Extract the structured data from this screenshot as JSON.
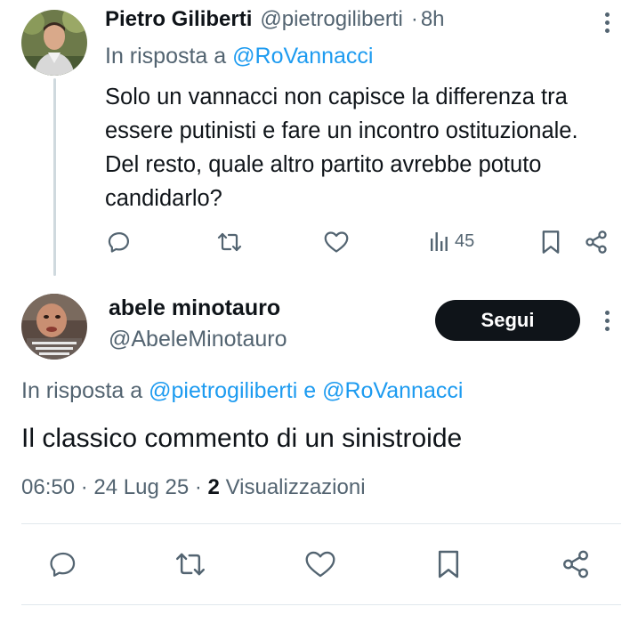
{
  "parent_tweet": {
    "author_name": "Pietro Giliberti",
    "author_handle": "@pietrogiliberti",
    "separator": "·",
    "time": "8h",
    "reply_prefix": "In risposta a",
    "reply_mention": "@RoVannacci",
    "text": "Solo un vannacci non capisce la differenza tra essere putinisti e fare un incontro ostituzionale. Del resto, quale altro partito avrebbe potuto candidarlo?",
    "views_count": "45",
    "icons": [
      "reply-icon",
      "retweet-icon",
      "like-icon",
      "views-icon",
      "bookmark-icon",
      "share-icon",
      "more-icon"
    ]
  },
  "reply_tweet": {
    "author_name": "abele minotauro",
    "author_handle": "@AbeleMinotauro",
    "follow_label": "Segui",
    "reply_prefix": "In risposta a",
    "reply_mention_1": "@pietrogiliberti",
    "reply_conjunction": "e",
    "reply_mention_2": "@RoVannacci",
    "text": "Il classico commento di un sinistroide",
    "time": "06:50",
    "date": "24 Lug 25",
    "separator": "·",
    "views_count": "2",
    "views_label": "Visualizzazioni",
    "icons": [
      "reply-icon",
      "retweet-icon",
      "like-icon",
      "bookmark-icon",
      "share-icon",
      "more-icon"
    ]
  },
  "colors": {
    "text_primary": "#0f1419",
    "text_secondary": "#536471",
    "link": "#1d9bf0",
    "follow_bg": "#0f1419",
    "divider": "#e1e8ed"
  }
}
